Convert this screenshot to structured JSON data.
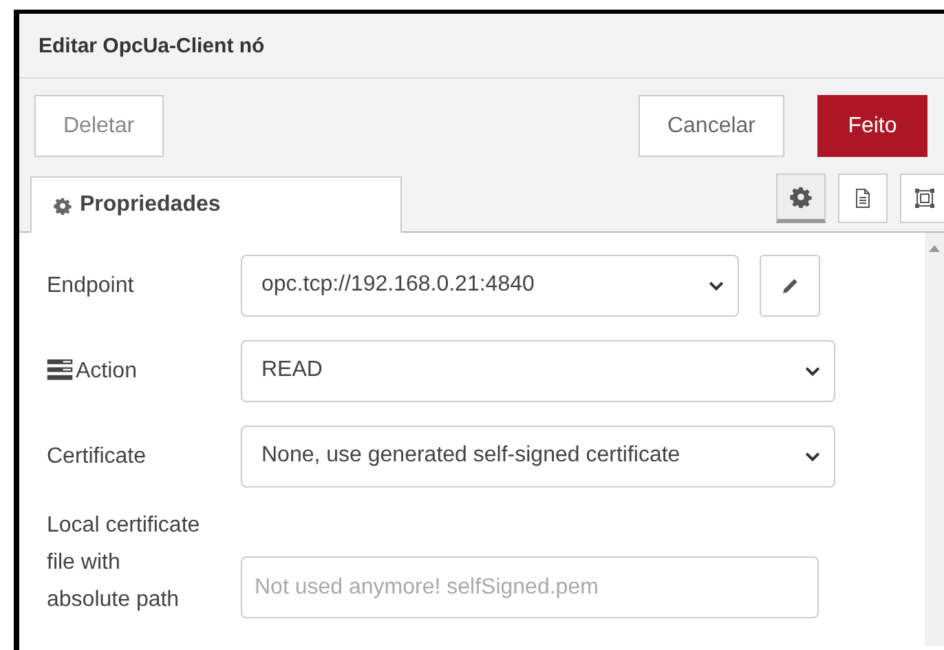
{
  "dialog": {
    "title": "Editar OpcUa-Client nó"
  },
  "buttons": {
    "delete": "Deletar",
    "cancel": "Cancelar",
    "done": "Feito"
  },
  "tabs": [
    {
      "label": "Propriedades",
      "selected": true
    }
  ],
  "icon_tabs": [
    {
      "selected": true
    },
    {
      "selected": false
    },
    {
      "selected": false
    }
  ],
  "form": [
    {
      "kind": "select",
      "label": "Endpoint",
      "value": "opc.tcp://192.168.0.21:4840",
      "edit_button": true
    },
    {
      "kind": "select",
      "label": "Action",
      "label_icon": true,
      "value": "READ"
    },
    {
      "kind": "select",
      "label": "Certificate",
      "value": "None, use generated self-signed certificate"
    },
    {
      "kind": "input",
      "label": "Local certificate file with absolute path",
      "placeholder": "Not used anymore! selfSigned.pem"
    }
  ]
}
